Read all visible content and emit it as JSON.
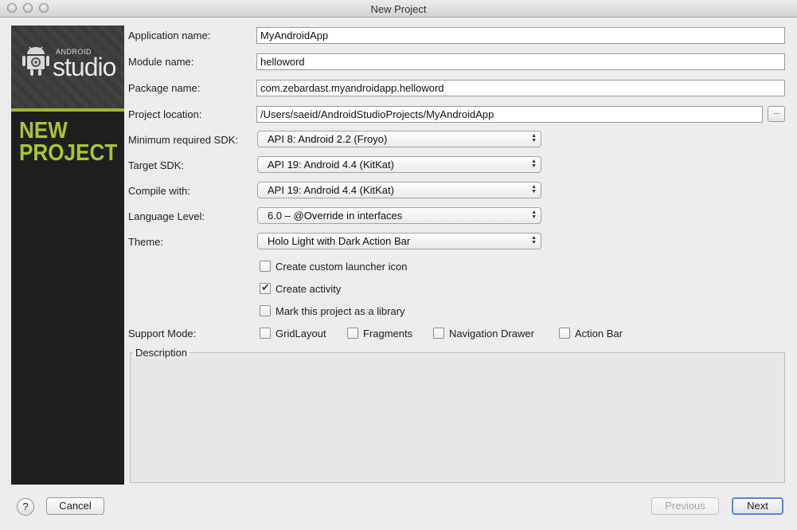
{
  "window": {
    "title": "New Project"
  },
  "banner": {
    "brand_small": "ANDROID",
    "brand_big": "studio",
    "heading_line1": "NEW",
    "heading_line2": "PROJECT"
  },
  "form": {
    "application_name": {
      "label": "Application name:",
      "value": "MyAndroidApp"
    },
    "module_name": {
      "label": "Module name:",
      "value": "helloword"
    },
    "package_name": {
      "label": "Package name:",
      "value": "com.zebardast.myandroidapp.helloword"
    },
    "project_location": {
      "label": "Project location:",
      "value": "/Users/saeid/AndroidStudioProjects/MyAndroidApp",
      "browse_label": "..."
    },
    "min_sdk": {
      "label": "Minimum required SDK:",
      "value": "API 8: Android 2.2 (Froyo)"
    },
    "target_sdk": {
      "label": "Target SDK:",
      "value": "API 19: Android 4.4 (KitKat)"
    },
    "compile_with": {
      "label": "Compile with:",
      "value": "API 19: Android 4.4 (KitKat)"
    },
    "language_level": {
      "label": "Language Level:",
      "value": "6.0 – @Override in interfaces"
    },
    "theme": {
      "label": "Theme:",
      "value": "Holo Light with Dark Action Bar"
    },
    "options": [
      {
        "label": "Create custom launcher icon",
        "checked": false
      },
      {
        "label": "Create activity",
        "checked": true
      },
      {
        "label": "Mark this project as a library",
        "checked": false
      }
    ],
    "support_mode": {
      "label": "Support Mode:",
      "items": [
        {
          "label": "GridLayout",
          "checked": false
        },
        {
          "label": "Fragments",
          "checked": false
        },
        {
          "label": "Navigation Drawer",
          "checked": false
        },
        {
          "label": "Action Bar",
          "checked": false
        }
      ]
    },
    "description": {
      "label": "Description"
    }
  },
  "footer": {
    "help_label": "?",
    "cancel_label": "Cancel",
    "previous_label": "Previous",
    "next_label": "Next"
  }
}
